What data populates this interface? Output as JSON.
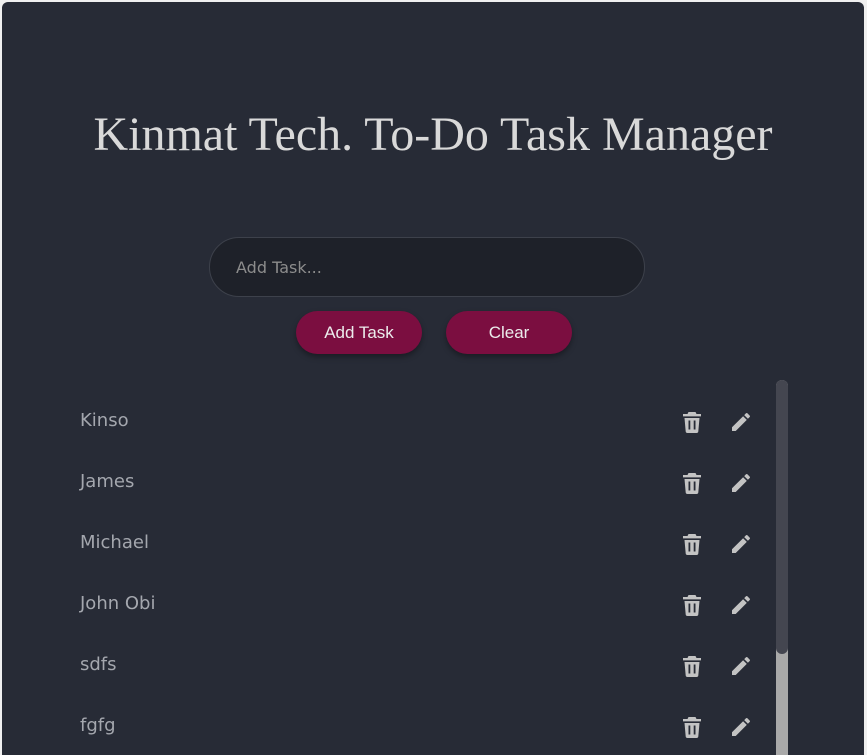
{
  "header": {
    "title": "Kinmat Tech. To-Do Task Manager"
  },
  "form": {
    "input_placeholder": "Add Task...",
    "input_value": "",
    "add_label": "Add Task",
    "clear_label": "Clear"
  },
  "tasks": [
    {
      "label": "Kinso"
    },
    {
      "label": "James"
    },
    {
      "label": "Michael"
    },
    {
      "label": "John Obi"
    },
    {
      "label": "sdfs"
    },
    {
      "label": "fgfg"
    }
  ],
  "icons": {
    "delete": "trash-icon",
    "edit": "pencil-icon"
  },
  "colors": {
    "background": "#272b36",
    "accent": "#7b0e40",
    "input_bg": "#1e2129",
    "text": "#d9d9d9",
    "muted_text": "#a4a7ae",
    "icon": "#c3c3c3"
  }
}
